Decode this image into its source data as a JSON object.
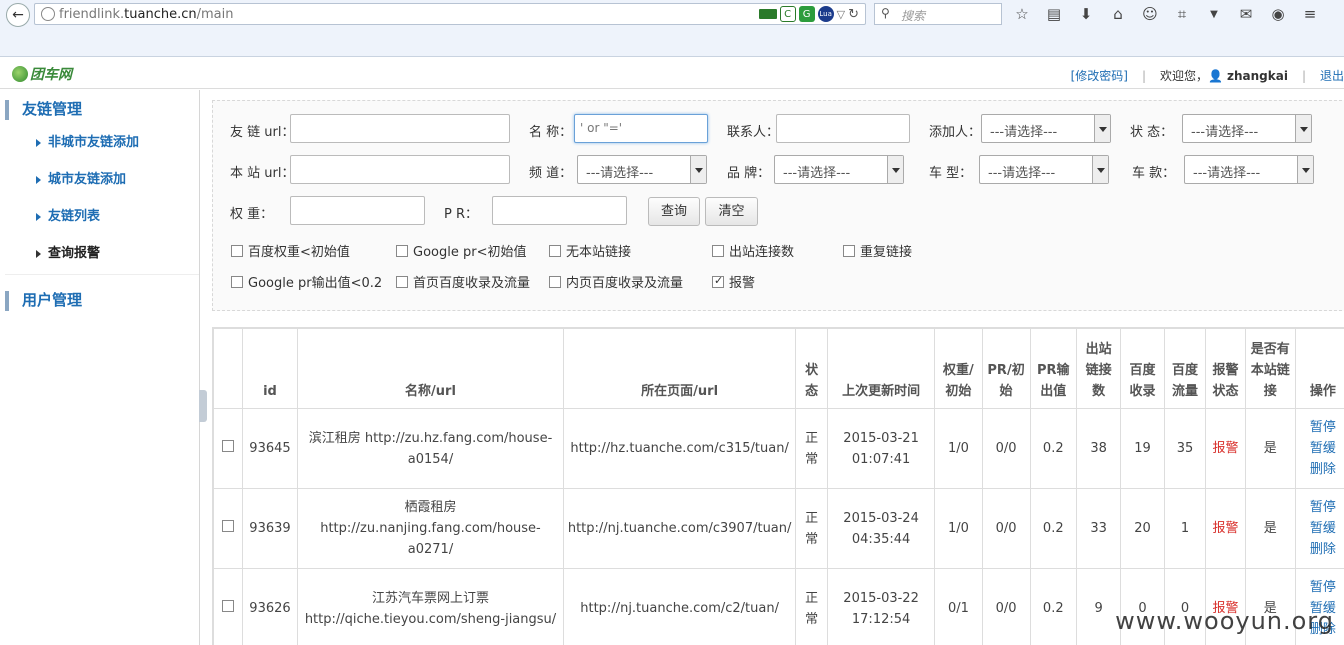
{
  "browser": {
    "url_prefix": "friendlink.",
    "url_domain": "tuanche.cn",
    "url_path": "/main",
    "search_placeholder": "搜索",
    "ext_labels": [
      "",
      "C",
      "G",
      "Lua"
    ]
  },
  "header": {
    "logo_text": "团车网",
    "change_password": "[修改密码]",
    "welcome": "欢迎您，",
    "username": "zhangkai",
    "logout": "退出"
  },
  "sidebar": {
    "section1": "友链管理",
    "items": [
      "非城市友链添加",
      "城市友链添加",
      "友链列表",
      "查询报警"
    ],
    "section2": "用户管理"
  },
  "filter": {
    "labels": {
      "friend_url": "友 链 url：",
      "name": "名  称：",
      "contact": "联系人：",
      "adder": "添加人：",
      "status": "状  态：",
      "site_url": "本 站 url：",
      "channel": "频  道：",
      "brand": "品  牌：",
      "car_type": "车  型：",
      "car_model": "车  款：",
      "weight": "权   重：",
      "pr": "P   R："
    },
    "name_value": "' or \"='",
    "select_placeholder": "---请选择---",
    "query_button": "查询",
    "clear_button": "清空",
    "checkboxes": [
      {
        "label": "百度权重<初始值",
        "checked": false
      },
      {
        "label": "Google pr<初始值",
        "checked": false
      },
      {
        "label": "无本站链接",
        "checked": false
      },
      {
        "label": "出站连接数",
        "checked": false
      },
      {
        "label": "重复链接",
        "checked": false
      },
      {
        "label": "Google pr输出值<0.2",
        "checked": false
      },
      {
        "label": "首页百度收录及流量",
        "checked": false
      },
      {
        "label": "内页百度收录及流量",
        "checked": false
      },
      {
        "label": "报警",
        "checked": true
      }
    ]
  },
  "table": {
    "headers": [
      "",
      "id",
      "名称/url",
      "所在页面/url",
      "状态",
      "上次更新时间",
      "权重/初始",
      "PR/初始",
      "PR输出值",
      "出站链接数",
      "百度收录",
      "百度流量",
      "报警状态",
      "是否有本站链接",
      "操作"
    ],
    "rows": [
      {
        "id": "93645",
        "name": "滨江租房 http://zu.hz.fang.com/house-a0154/",
        "page": "http://hz.tuanche.com/c315/tuan/",
        "status": "正常",
        "time": "2015-03-21 01:07:41",
        "weight": "1/0",
        "pr": "0/0",
        "pr_out": "0.2",
        "out_links": "38",
        "bd_index": "19",
        "bd_traffic": "35",
        "alarm": "报警",
        "has_link": "是",
        "ops": [
          "暂停",
          "暂缓",
          "删除"
        ]
      },
      {
        "id": "93639",
        "name": "栖霞租房 http://zu.nanjing.fang.com/house-a0271/",
        "page": "http://nj.tuanche.com/c3907/tuan/",
        "status": "正常",
        "time": "2015-03-24 04:35:44",
        "weight": "1/0",
        "pr": "0/0",
        "pr_out": "0.2",
        "out_links": "33",
        "bd_index": "20",
        "bd_traffic": "1",
        "alarm": "报警",
        "has_link": "是",
        "ops": [
          "暂停",
          "暂缓",
          "删除"
        ]
      },
      {
        "id": "93626",
        "name": "江苏汽车票网上订票 http://qiche.tieyou.com/sheng-jiangsu/",
        "page": "http://nj.tuanche.com/c2/tuan/",
        "status": "正常",
        "time": "2015-03-22 17:12:54",
        "weight": "0/1",
        "pr": "0/0",
        "pr_out": "0.2",
        "out_links": "9",
        "bd_index": "0",
        "bd_traffic": "0",
        "alarm": "报警",
        "has_link": "是",
        "ops": [
          "暂停",
          "暂缓",
          "删除"
        ]
      }
    ]
  },
  "watermark": "www.wooyun.org",
  "colors": {
    "link": "#1e6db3",
    "alarm": "#d9302c",
    "logo": "#3a8a3a"
  }
}
